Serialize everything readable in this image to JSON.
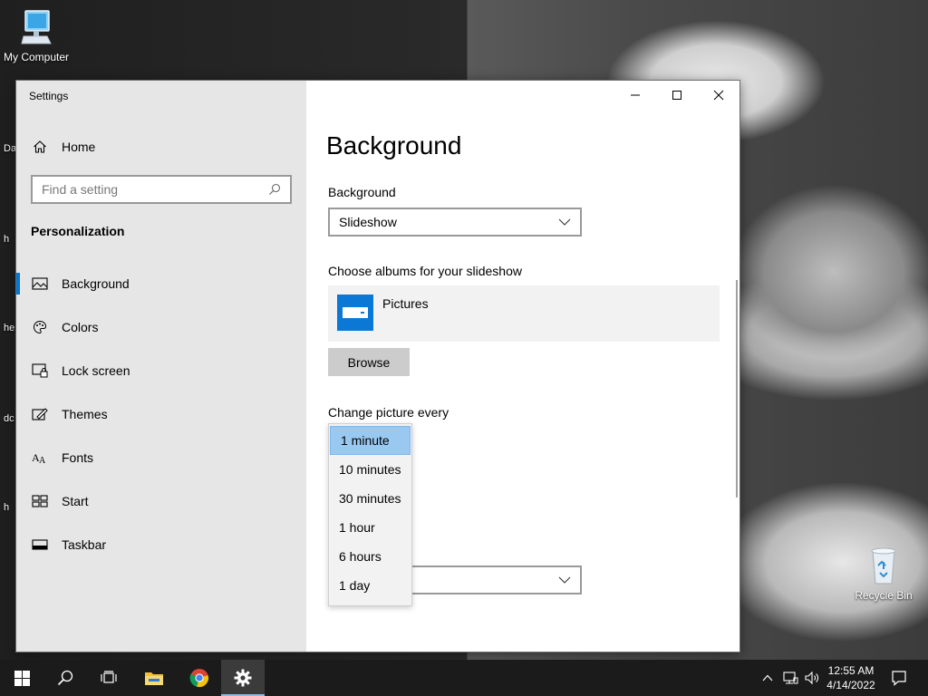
{
  "desktop": {
    "my_computer": "My Computer",
    "recycle_bin": "Recycle Bin",
    "edge_fragments": [
      "Da",
      "h",
      "he",
      "dc",
      "h"
    ]
  },
  "window": {
    "title": "Settings"
  },
  "sidebar": {
    "home": "Home",
    "search_placeholder": "Find a setting",
    "section": "Personalization",
    "items": [
      {
        "label": "Background",
        "icon": "picture-icon",
        "active": true
      },
      {
        "label": "Colors",
        "icon": "palette-icon"
      },
      {
        "label": "Lock screen",
        "icon": "lock-screen-icon"
      },
      {
        "label": "Themes",
        "icon": "themes-icon"
      },
      {
        "label": "Fonts",
        "icon": "fonts-icon"
      },
      {
        "label": "Start",
        "icon": "start-icon"
      },
      {
        "label": "Taskbar",
        "icon": "taskbar-icon"
      }
    ]
  },
  "main": {
    "title": "Background",
    "background_label": "Background",
    "background_value": "Slideshow",
    "albums_label": "Choose albums for your slideshow",
    "album_name": "Pictures",
    "browse_label": "Browse",
    "change_label": "Change picture every",
    "interval_options": [
      "1 minute",
      "10 minutes",
      "30 minutes",
      "1 hour",
      "6 hours",
      "1 day"
    ],
    "selected_interval": "1 minute"
  },
  "taskbar": {
    "time": "12:55 AM",
    "date": "4/14/2022"
  },
  "colors": {
    "accent": "#0078d7",
    "menu_highlight": "#99c9f1",
    "album_thumb": "#0a78d4"
  }
}
